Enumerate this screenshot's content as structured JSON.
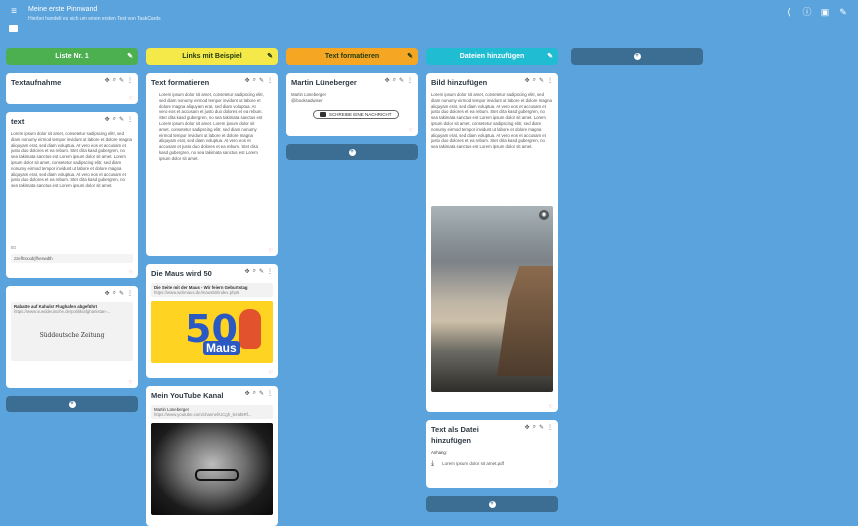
{
  "header": {
    "menu_icon": "menu-icon",
    "title": "Meine erste Pinnwand",
    "subtitle": "Hierbei handelt es sich um einen ersten Test von TaskCards",
    "actions": [
      "share-icon",
      "info-icon",
      "board-icon",
      "edit-icon"
    ]
  },
  "columns": [
    {
      "title": "Liste Nr. 1",
      "color": "#4caf50",
      "cards": [
        {
          "title": "Textaufnahme",
          "body": ""
        },
        {
          "title": "text",
          "body": "Lorem ipsum dolor sit amet, consetetur sadipscing elitr, sed diam nonumy eirmod tempor invidunt ut labore et dolore magna aliquyam erat, sed diam voluptua. At vero eos et accusam et justo duo dolores et ea rebum. Stet clita kasd gubergren, no sea takimata sanctus est Lorem ipsum dolor sit amet. Lorem ipsum dolor sit amet, consetetur sadipscing elitr, sed diam nonumy eirmod tempor invidunt ut labore et dolore magna aliquyam erat, sed diam voluptua. At vero eos et accusam et justo duo dolores et ea rebum. Stet clita kasd gubergren, no sea takimata sanctus est Lorem ipsum dolor sit amet.",
          "extra": "tttt",
          "field": "zzefhsxxdrjfheswdth"
        },
        {
          "title": "",
          "link_title": "Rabatte auf Kahuls! Flughafen abgeführt",
          "link_url": "https://www.sueddeutsche.de/politik/afghanistan-...",
          "source": "Süddeutsche Zeitung"
        }
      ]
    },
    {
      "title": "Links mit Beispiel",
      "color": "#f5e94a",
      "cards": [
        {
          "title": "Text formatieren",
          "body": "Lorem ipsum dolor sit amet, consetetur sadipscing elitr, sed diam nonumy eirmod tempor invidunt ut labore et dolore magna aliquyam erat, sed diam voluptua. At vero eos et accusam et justo duo dolores et ea rebum. Stet clita kasd gubergren, no sea takimata sanctus est Lorem ipsum dolor sit amet. Lorem ipsum dolor sit amet, consetetur sadipscing elitr, sed diam nonumy eirmod tempor invidunt ut labore et dolore magna aliquyam erat, sed diam voluptua. At vero eos et accusam et justo duo dolores et ea rebum. Stet clita kasd gubergren, no sea takimata sanctus est Lorem ipsum dolor sit amet."
        },
        {
          "title": "Die Maus wird 50",
          "link_title": "Die Seite mit der Maus - Wir feiern Geburtstag",
          "link_url": "https://www.wdrmaus.de/maus50/index.php5",
          "image_text": "50",
          "image_sub": "Maus"
        },
        {
          "title": "Mein YouTube Kanal",
          "link_title": "Martin Lüneberger",
          "link_url": "https://www.youtube.com/channel/UCgh_lsHd6Rf..."
        }
      ]
    },
    {
      "title": "Text formatieren",
      "color": "#f5a623",
      "cards": [
        {
          "title": "Martin Lüneberger",
          "body": "Martin Lüneberger @ibooksadwiser",
          "chip": "SCHREIBE EINE NACHRICHT"
        }
      ]
    },
    {
      "title": "Dateien hinzufügen",
      "color": "#1fbcd2",
      "cards": [
        {
          "title": "Bild hinzufügen",
          "body": "Lorem ipsum dolor sit amet, consetetur sadipscing elitr, sed diam nonumy eirmod tempor invidunt ut labore et dolore magna aliquyam erat, sed diam voluptua. At vero eos et accusam et justo duo dolores et ea rebum. Stet clita kasd gubergren, no sea takimata sanctus est Lorem ipsum dolor sit amet. Lorem ipsum dolor sit amet, consetetur sadipscing elitr, sed diam nonumy eirmod tempor invidunt ut labore et dolore magna aliquyam erat, sed diam voluptua. At vero eos et accusam et justo duo dolores et ea rebum. Stet clita kasd gubergren, no sea takimata sanctus est Lorem ipsum dolor sit amet."
        },
        {
          "title": "Text als Datei hinzufügen",
          "attach_label": "Anhang:",
          "file_name": "Lorem ipsum dolor sit amet.pdf"
        }
      ]
    }
  ],
  "card_tools": [
    "move-icon",
    "search-icon",
    "edit-icon",
    "more-icon"
  ],
  "like_icon": "heart-icon"
}
